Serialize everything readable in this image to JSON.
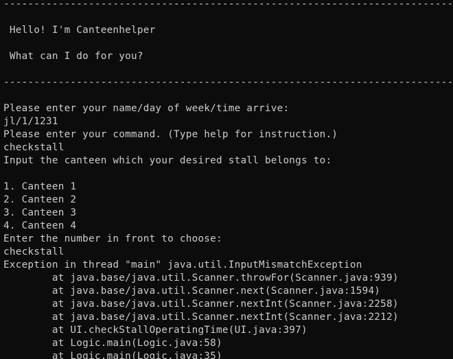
{
  "window": {
    "background": "#0c0c0c",
    "foreground": "#cccccc"
  },
  "lines": [
    "----------------------------------------------------------------------------",
    "",
    " Hello! I'm Canteenhelper",
    "",
    " What can I do for you?",
    "",
    "----------------------------------------------------------------------------",
    "",
    "Please enter your name/day of week/time arrive:",
    "jl/1/1231",
    "Please enter your command. (Type help for instruction.)",
    "checkstall",
    "Input the canteen which your desired stall belongs to:",
    "",
    "1. Canteen 1",
    "2. Canteen 2",
    "3. Canteen 3",
    "4. Canteen 4",
    "Enter the number in front to choose:",
    "checkstall",
    "Exception in thread \"main\" java.util.InputMismatchException",
    "        at java.base/java.util.Scanner.throwFor(Scanner.java:939)",
    "        at java.base/java.util.Scanner.next(Scanner.java:1594)",
    "        at java.base/java.util.Scanner.nextInt(Scanner.java:2258)",
    "        at java.base/java.util.Scanner.nextInt(Scanner.java:2212)",
    "        at UI.checkStallOperatingTime(UI.java:397)",
    "        at Logic.main(Logic.java:58)",
    "        at Logic.main(Logic.java:35)"
  ]
}
